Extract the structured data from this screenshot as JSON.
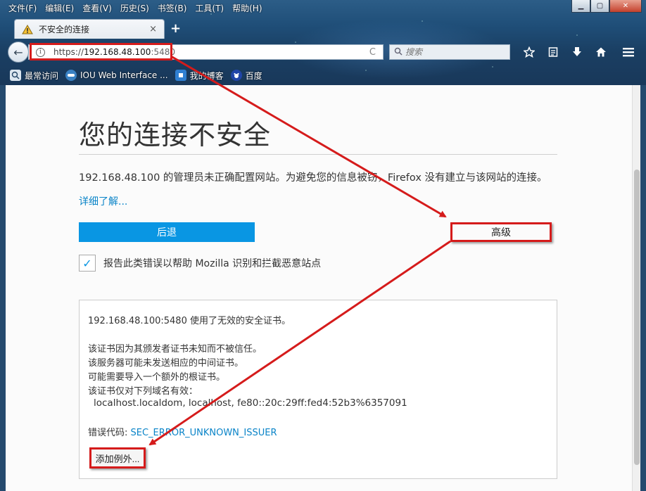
{
  "menubar": {
    "items": [
      "文件(F)",
      "编辑(E)",
      "查看(V)",
      "历史(S)",
      "书签(B)",
      "工具(T)",
      "帮助(H)"
    ]
  },
  "window_controls": {
    "minimize": "▁",
    "maximize": "▢",
    "close": "✕"
  },
  "tab": {
    "title": "不安全的连接",
    "close": "×",
    "new_tab": "+"
  },
  "navbar": {
    "back": "←",
    "info": "i",
    "url_scheme": "https://",
    "url_host": "192.168.48.100",
    "url_port": ":5480",
    "reload": "C",
    "search_placeholder": "搜索",
    "icons": [
      "star-icon",
      "reading-list-icon",
      "download-icon",
      "home-icon",
      "menu-icon"
    ]
  },
  "bookmarks": {
    "items": [
      {
        "label": "最常访问",
        "icon": "most-visited-icon"
      },
      {
        "label": "IOU Web Interface ...",
        "icon": "iou-icon"
      },
      {
        "label": "我的博客",
        "icon": "blog-icon"
      },
      {
        "label": "百度",
        "icon": "baidu-icon"
      }
    ]
  },
  "page": {
    "title": "您的连接不安全",
    "description": "192.168.48.100 的管理员未正确配置网站。为避免您的信息被窃，Firefox 没有建立与该网站的连接。",
    "learn_more": "详细了解...",
    "back_button": "后退",
    "advanced_button": "高级",
    "report_label": "报告此类错误以帮助 Mozilla 识别和拦截恶意站点",
    "report_checked": true,
    "check_mark": "✓"
  },
  "advanced": {
    "summary": "192.168.48.100:5480 使用了无效的安全证书。",
    "reasons": [
      "该证书因为其颁发者证书未知而不被信任。",
      "该服务器可能未发送相应的中间证书。",
      "可能需要导入一个额外的根证书。",
      "该证书仅对下列域名有效："
    ],
    "domains": "localhost.localdom, localhost, fe80::20c:29ff:fed4:52b3%6357091",
    "error_label": "错误代码: ",
    "error_code": "SEC_ERROR_UNKNOWN_ISSUER",
    "add_exception": "添加例外..."
  },
  "colors": {
    "accent": "#0996e3",
    "link": "#0a84c8",
    "annotation": "#d51b1b"
  }
}
